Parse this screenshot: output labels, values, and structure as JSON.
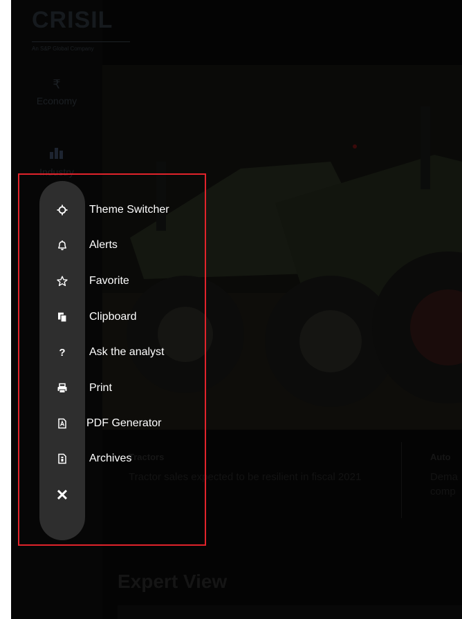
{
  "brand": {
    "name": "CRISIL",
    "tagline": "An S&P Global Company"
  },
  "nav": [
    {
      "glyph": "₹",
      "label": "Economy"
    },
    {
      "glyph": "bar-chart-icon",
      "label": "Industry"
    }
  ],
  "cards": [
    {
      "category": "Tractors",
      "text": "Tractor sales expected to be resilient in fiscal 2021"
    },
    {
      "category": "Auto",
      "text": "Dema comp"
    }
  ],
  "section_title": "Expert View",
  "menu": {
    "items": [
      {
        "icon": "theme-icon",
        "label": "Theme Switcher"
      },
      {
        "icon": "bell-icon",
        "label": "Alerts"
      },
      {
        "icon": "star-icon",
        "label": "Favorite"
      },
      {
        "icon": "clipboard-icon",
        "label": "Clipboard"
      },
      {
        "icon": "question-icon",
        "label": "Ask the analyst"
      },
      {
        "icon": "print-icon",
        "label": "Print"
      },
      {
        "icon": "pdf-icon",
        "label": "PDF Generator"
      },
      {
        "icon": "archive-icon",
        "label": "Archives"
      }
    ],
    "close_glyph": "✕"
  },
  "colors": {
    "highlight": "#e2232b",
    "menu_bg": "#2e2e2e",
    "overlay": "#040404"
  }
}
